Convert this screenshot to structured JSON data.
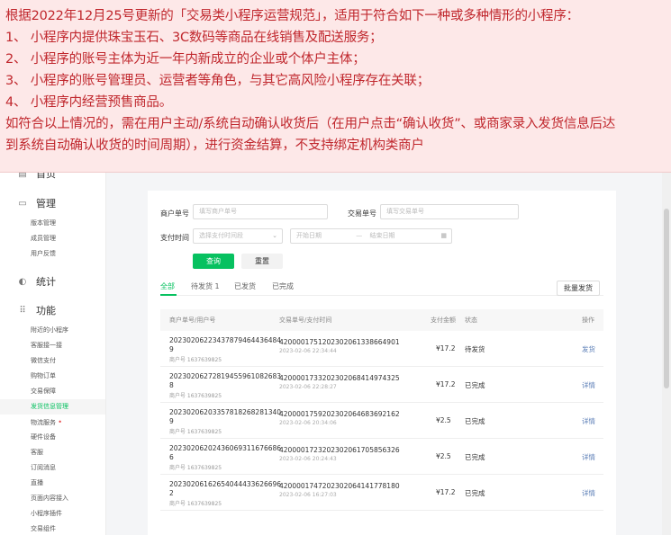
{
  "banner": {
    "intro": "根据2022年12月25号更新的「交易类小程序运营规范」，适用于符合如下一种或多种情形的小程序：",
    "items": [
      "1、 小程序内提供珠宝玉石、3C数码等商品在线销售及配送服务；",
      "2、 小程序的账号主体为近一年内新成立的企业或个体户主体；",
      "3、 小程序的账号管理员、运营者等角色，与其它高风险小程序存在关联；",
      "4、 小程序内经营预售商品。"
    ],
    "note_line1": "如符合以上情况的，需在用户主动/系统自动确认收货后（在用户点击“确认收货”、或商家录入发货信息后达",
    "note_line2": "到系统自动确认收货的时间周期），进行资金结算，不支持绑定机构类商户",
    "text_color": "#c0272d",
    "bg_color": "#fde8e8"
  },
  "sidebar": {
    "top_item": "首页",
    "groups": [
      {
        "icon": "manage-icon",
        "label": "管理",
        "items": [
          "版本管理",
          "成员管理",
          "用户反馈"
        ]
      },
      {
        "icon": "stats-icon",
        "label": "统计",
        "items": []
      },
      {
        "icon": "function-icon",
        "label": "功能",
        "items": [
          "附近的小程序",
          "客服接一接",
          "微信支付",
          "购物订单",
          "交易保障",
          "发货信息管理",
          "物流服务",
          "硬件设备",
          "客服",
          "订阅消息",
          "直播",
          "页面内容接入",
          "小程序插件",
          "交易组件"
        ]
      }
    ],
    "active_item": "发货信息管理",
    "badge_item": "物流服务",
    "badge": "•",
    "accent_color": "#07c160"
  },
  "filters": {
    "merchant_order_label": "商户单号",
    "merchant_order_placeholder": "填写商户单号",
    "trade_no_label": "交易单号",
    "trade_no_placeholder": "填写交易单号",
    "pay_time_label": "支付时间",
    "pay_time_select": "选择支付时间段",
    "start_date": "开始日期",
    "date_sep": "—",
    "end_date": "结束日期",
    "query_button": "查询",
    "reset_button": "重置"
  },
  "tabs": [
    {
      "label": "全部",
      "active": true
    },
    {
      "label": "待发货 1",
      "active": false
    },
    {
      "label": "已发货",
      "active": false
    },
    {
      "label": "已完成",
      "active": false
    }
  ],
  "batch_button": "批量发货",
  "table": {
    "headers": [
      "商户单号/用户号",
      "交易单号/支付时间",
      "支付金额",
      "状态",
      "操作"
    ],
    "rows": [
      {
        "order": "20230206223437879464436484",
        "order_tail": "9",
        "user": "商户号 1637639825",
        "tx": "4200001751202302061338664901",
        "time": "2023-02-06 22:34:44",
        "amount": "¥17.2",
        "status": "待发货",
        "action": "发货"
      },
      {
        "order": "20230206272819455961082683",
        "order_tail": "8",
        "user": "商户号 1637639825",
        "tx": "4200001733202302068414974325",
        "time": "2023-02-06 22:28:27",
        "amount": "¥17.2",
        "status": "已完成",
        "action": "详情"
      },
      {
        "order": "20230206203357818268281340",
        "order_tail": "9",
        "user": "商户号 1637639825",
        "tx": "4200001759202302064683692162",
        "time": "2023-02-06 20:34:06",
        "amount": "¥2.5",
        "status": "已完成",
        "action": "详情"
      },
      {
        "order": "20230206202436069311676686",
        "order_tail": "6",
        "user": "商户号 1637639825",
        "tx": "4200001723202302061705856326",
        "time": "2023-02-06 20:24:43",
        "amount": "¥2.5",
        "status": "已完成",
        "action": "详情"
      },
      {
        "order": "20230206162654044433626696",
        "order_tail": "2",
        "user": "商户号 1637639825",
        "tx": "4200001747202302064141778180",
        "time": "2023-02-06 16:27:03",
        "amount": "¥17.2",
        "status": "已完成",
        "action": "详情"
      }
    ]
  }
}
